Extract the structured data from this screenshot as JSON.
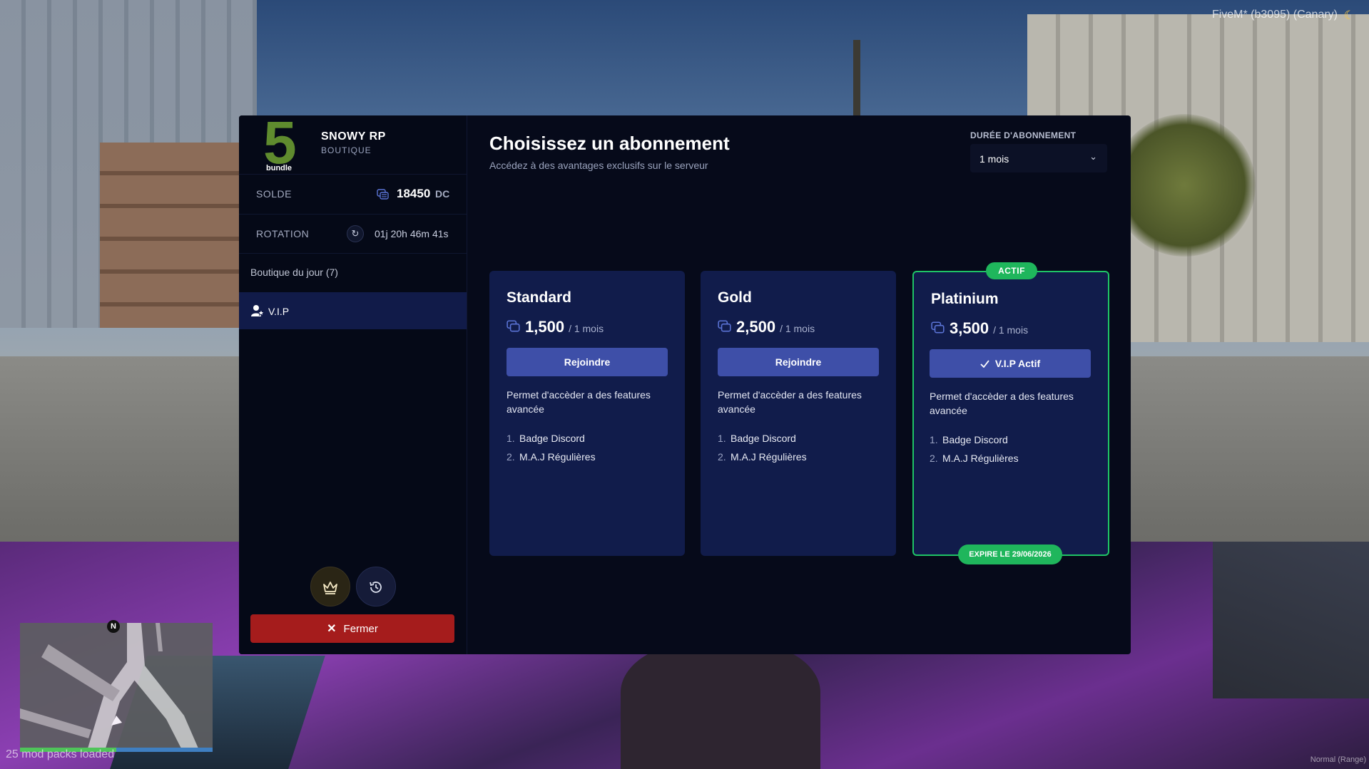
{
  "overlay": {
    "fivem_label": "FiveM* (b3095) (Canary)",
    "mod_packs": "25 mod packs loaded",
    "mode_label": "Normal (Range)",
    "compass": "N"
  },
  "brand": {
    "logo_digit": "5",
    "logo_word": "bundle",
    "title": "SNOWY RP",
    "subtitle": "BOUTIQUE",
    "logo_color": "#5f8b2e"
  },
  "sidebar": {
    "solde_label": "SOLDE",
    "solde_value": "18450",
    "solde_unit": "DC",
    "rotation_label": "ROTATION",
    "rotation_value": "01j 20h 46m 41s",
    "items": [
      {
        "label": "Boutique du jour (7)"
      },
      {
        "label": "V.I.P",
        "icon": "user-star-icon",
        "active": true
      }
    ],
    "close_label": "Fermer"
  },
  "main": {
    "title": "Choisissez un abonnement",
    "subtitle": "Accédez à des avantages exclusifs sur le serveur",
    "duration_label": "DURÉE D'ABONNEMENT",
    "duration_value": "1 mois"
  },
  "plans": [
    {
      "name": "Standard",
      "price": "1,500",
      "period": "/ 1 mois",
      "button": "Rejoindre",
      "description": "Permet d'accèder a des features avancée",
      "features": [
        {
          "num": "1.",
          "text": "Badge Discord"
        },
        {
          "num": "2.",
          "text": "M.A.J Régulières"
        }
      ]
    },
    {
      "name": "Gold",
      "price": "2,500",
      "period": "/ 1 mois",
      "button": "Rejoindre",
      "description": "Permet d'accèder a des features avancée",
      "features": [
        {
          "num": "1.",
          "text": "Badge Discord"
        },
        {
          "num": "2.",
          "text": "M.A.J Régulières"
        }
      ]
    },
    {
      "name": "Platinium",
      "price": "3,500",
      "period": "/ 1 mois",
      "button": "V.I.P Actif",
      "description": "Permet d'accèder a des features avancée",
      "features": [
        {
          "num": "1.",
          "text": "Badge Discord"
        },
        {
          "num": "2.",
          "text": "M.A.J Régulières"
        }
      ],
      "badge_top": "ACTIF",
      "badge_bottom": "EXPIRE LE 29/06/2026",
      "active": true
    }
  ],
  "colors": {
    "panel_bg": "#060a1a",
    "card_bg": "#111c4b",
    "button_primary": "#3e4fa8",
    "active_green": "#1fb65c",
    "close_red": "#a51c1c"
  }
}
